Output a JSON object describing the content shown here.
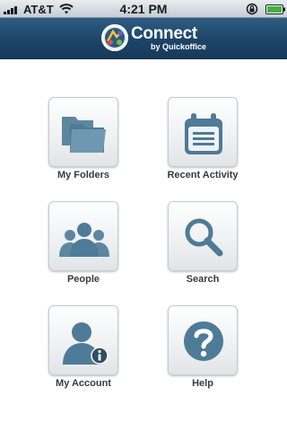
{
  "status_bar": {
    "carrier": "AT&T",
    "time": "4:21 PM"
  },
  "header": {
    "title": "Connect",
    "subtitle": "by Quickoffice"
  },
  "menu": {
    "my_folders": "My Folders",
    "recent_activity": "Recent Activity",
    "people": "People",
    "search": "Search",
    "my_account": "My Account",
    "help": "Help"
  },
  "icons": {
    "my_folders": "folder-icon",
    "recent_activity": "calendar-list-icon",
    "people": "people-icon",
    "search": "magnifier-icon",
    "my_account": "user-info-icon",
    "help": "question-icon"
  },
  "colors": {
    "header": "#1d4468",
    "icon": "#4e7b97",
    "label": "#3a3a3a"
  }
}
